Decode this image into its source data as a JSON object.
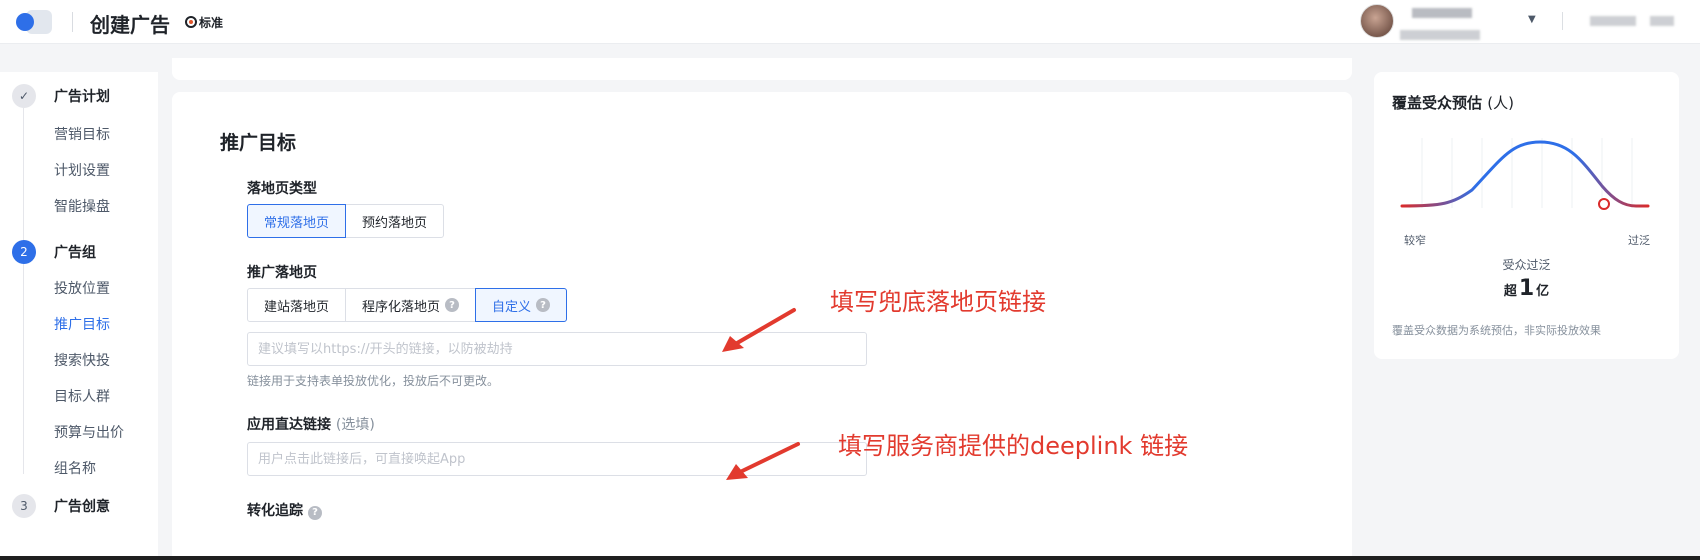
{
  "header": {
    "title": "创建广告",
    "badge": "标准"
  },
  "sidebar": {
    "steps": [
      {
        "number": "✓",
        "label": "广告计划",
        "items": [
          "营销目标",
          "计划设置",
          "智能操盘"
        ]
      },
      {
        "number": "2",
        "label": "广告组",
        "items": [
          "投放位置",
          "推广目标",
          "搜索快投",
          "目标人群",
          "预算与出价",
          "组名称"
        ],
        "active_item": "推广目标"
      },
      {
        "number": "3",
        "label": "广告创意",
        "items": []
      }
    ]
  },
  "main": {
    "section_title": "推广目标",
    "landing_type": {
      "label": "落地页类型",
      "options": [
        "常规落地页",
        "预约落地页"
      ],
      "selected": "常规落地页"
    },
    "promo_landing": {
      "label": "推广落地页",
      "options": [
        "建站落地页",
        "程序化落地页",
        "自定义"
      ],
      "selected": "自定义",
      "placeholder": "建议填写以https://开头的链接，以防被劫持",
      "hint": "链接用于支持表单投放优化，投放后不可更改。"
    },
    "app_link": {
      "label": "应用直达链接",
      "optional": "(选填)",
      "placeholder": "用户点击此链接后，可直接唤起App"
    },
    "conversion": {
      "label": "转化追踪"
    }
  },
  "annotations": {
    "first": "填写兜底落地页链接",
    "second": "填写服务商提供的deeplink 链接",
    "color": "#e23a2e"
  },
  "audience": {
    "title": "覆盖受众预估",
    "unit": "(人)",
    "narrow": "较窄",
    "broad": "过泛",
    "status": "受众过泛",
    "prefix": "超",
    "value": "1",
    "suffix": "亿",
    "note": "覆盖受众数据为系统预估，非实际投放效果"
  },
  "colors": {
    "accent": "#2e6fe8",
    "curve_blue": "#2e6fe8",
    "curve_red": "#d92b2b"
  }
}
